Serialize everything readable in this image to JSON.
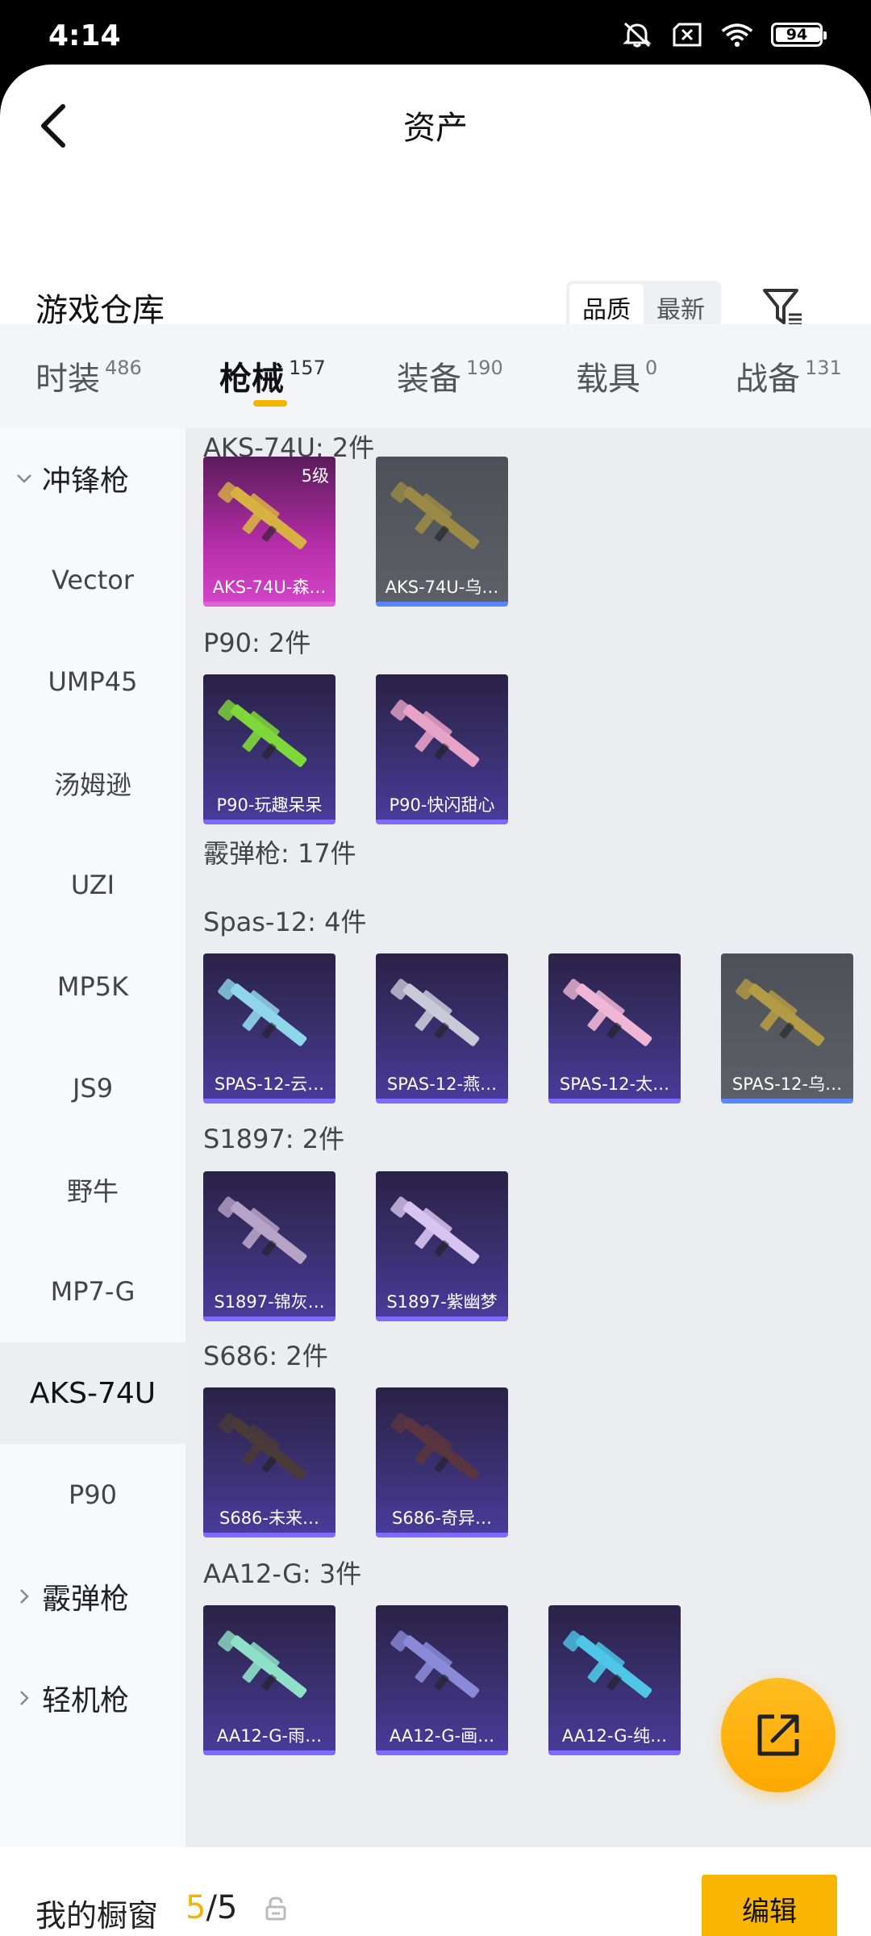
{
  "status_bar": {
    "time": "4:14",
    "battery": "94",
    "battery_level": 0.94
  },
  "header": {
    "title": "资产"
  },
  "warehouse": {
    "title": "游戏仓库",
    "sort_options": [
      "品质",
      "最新"
    ],
    "active_sort": "品质"
  },
  "tabs": [
    {
      "label": "时装",
      "count": "486"
    },
    {
      "label": "枪械",
      "count": "157",
      "active": true
    },
    {
      "label": "装备",
      "count": "190"
    },
    {
      "label": "载具",
      "count": "0"
    },
    {
      "label": "战备",
      "count": "131"
    }
  ],
  "sidebar": {
    "items": [
      {
        "label": "冲锋枪",
        "type": "group",
        "expanded": true
      },
      {
        "label": "Vector"
      },
      {
        "label": "UMP45"
      },
      {
        "label": "汤姆逊"
      },
      {
        "label": "UZI"
      },
      {
        "label": "MP5K"
      },
      {
        "label": "JS9"
      },
      {
        "label": "野牛"
      },
      {
        "label": "MP7-G"
      },
      {
        "label": "AKS-74U",
        "active": true
      },
      {
        "label": "P90"
      },
      {
        "label": "霰弹枪",
        "type": "group",
        "expanded": false
      },
      {
        "label": "轻机枪",
        "type": "group",
        "expanded": false
      }
    ]
  },
  "sections": [
    {
      "title": "AKS-74U: 2件",
      "cards": [
        {
          "name": "AKS-74U-森…",
          "style": "pink",
          "level": "5级",
          "gun_color": "#d7b243"
        },
        {
          "name": "AKS-74U-乌…",
          "style": "gray",
          "gun_color": "#9a8a45"
        }
      ]
    },
    {
      "title": "P90: 2件",
      "cards": [
        {
          "name": "P90-玩趣呆呆",
          "style": "purple",
          "gun_color": "#7fd83a"
        },
        {
          "name": "P90-快闪甜心",
          "style": "purple",
          "gun_color": "#e7a2c8"
        }
      ]
    },
    {
      "title": "霰弹枪: 17件",
      "cards": []
    },
    {
      "title": "Spas-12: 4件",
      "cards": [
        {
          "name": "SPAS-12-云…",
          "style": "purple",
          "gun_color": "#8fd6ea"
        },
        {
          "name": "SPAS-12-燕…",
          "style": "purple",
          "gun_color": "#c9c9d8"
        },
        {
          "name": "SPAS-12-太…",
          "style": "purple",
          "gun_color": "#f0b6d6"
        },
        {
          "name": "SPAS-12-乌…",
          "style": "gray",
          "gun_color": "#b39a45"
        }
      ]
    },
    {
      "title": "S1897: 2件",
      "cards": [
        {
          "name": "S1897-锦灰…",
          "style": "purple",
          "gun_color": "#b8a3c8"
        },
        {
          "name": "S1897-紫幽梦",
          "style": "purple",
          "gun_color": "#d8c4f0"
        }
      ]
    },
    {
      "title": "S686: 2件",
      "cards": [
        {
          "name": "S686-未来…",
          "style": "purple",
          "gun_color": "#4a3a38"
        },
        {
          "name": "S686-奇异…",
          "style": "purple",
          "gun_color": "#5a3540"
        }
      ]
    },
    {
      "title": "AA12-G: 3件",
      "cards": [
        {
          "name": "AA12-G-雨…",
          "style": "purple",
          "gun_color": "#8fe0c8"
        },
        {
          "name": "AA12-G-画…",
          "style": "purple",
          "gun_color": "#8a8ad8"
        },
        {
          "name": "AA12-G-纯…",
          "style": "purple",
          "gun_color": "#4ec6e8"
        }
      ]
    }
  ],
  "bottom_bar": {
    "label": "我的橱窗",
    "current": "5",
    "separator": "/",
    "total": "5",
    "edit_label": "编辑"
  },
  "colors": {
    "accent": "#f5b400",
    "fab": "#ffab00"
  }
}
